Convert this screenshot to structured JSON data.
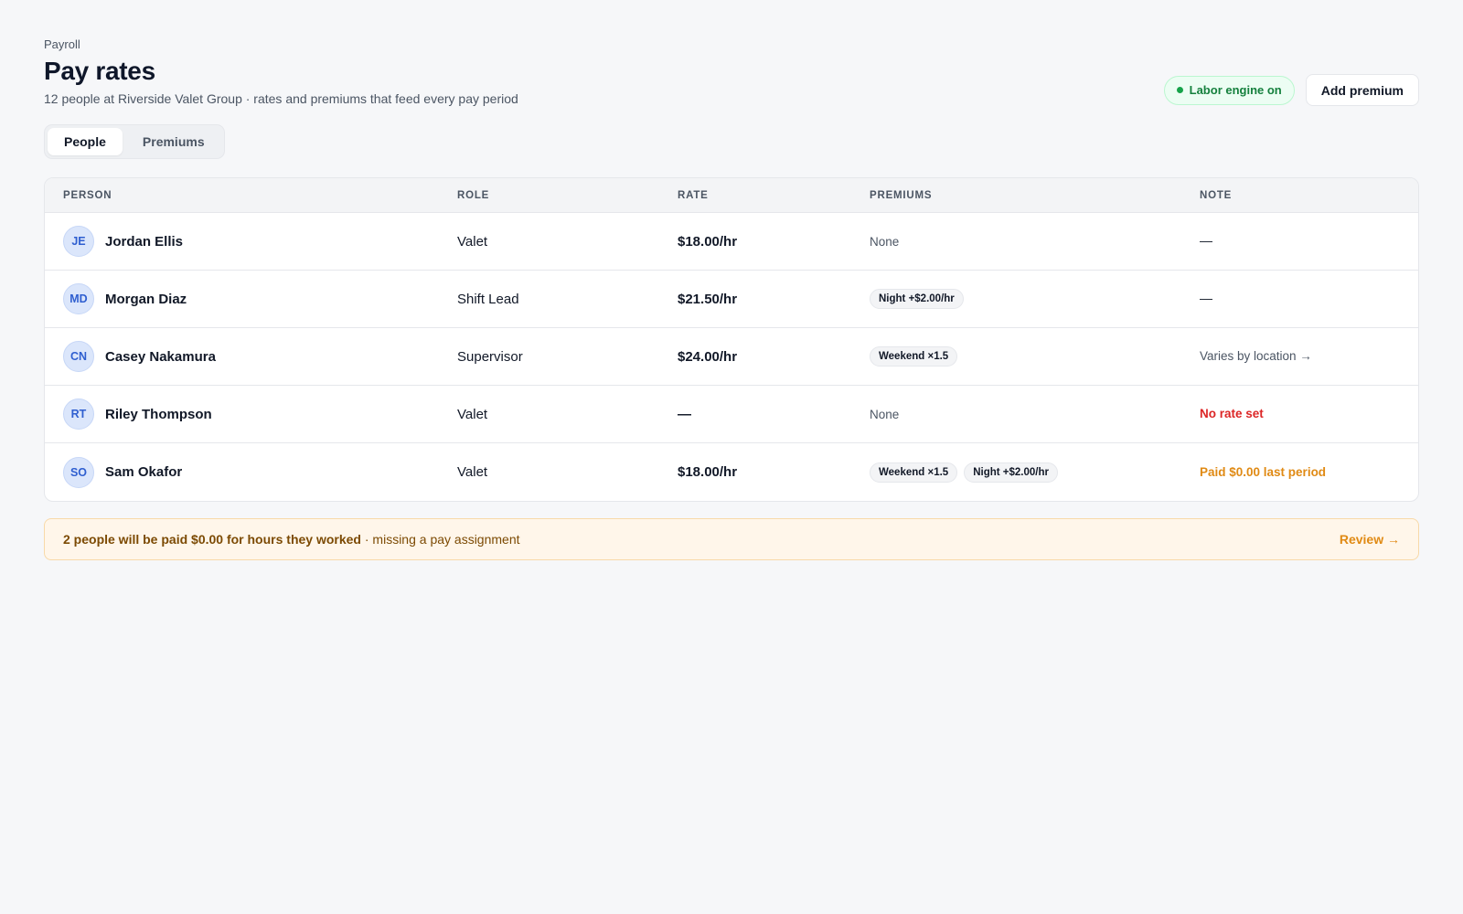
{
  "header": {
    "breadcrumb": "Payroll",
    "title": "Pay rates",
    "subtitle": "12 people at Riverside Valet Group · rates and premiums that feed every pay period",
    "engine_status": "Labor engine on",
    "add_button": "Add premium"
  },
  "tabs": [
    {
      "label": "People",
      "active": true
    },
    {
      "label": "Premiums",
      "active": false
    }
  ],
  "table": {
    "columns": [
      "PERSON",
      "ROLE",
      "RATE",
      "PREMIUMS",
      "NOTE"
    ],
    "rows": [
      {
        "initials": "JE",
        "name": "Jordan Ellis",
        "role": "Valet",
        "rate": "$18.00/hr",
        "premiums_none": "None",
        "premiums": [],
        "note": "—",
        "note_style": "dash"
      },
      {
        "initials": "MD",
        "name": "Morgan Diaz",
        "role": "Shift Lead",
        "rate": "$21.50/hr",
        "premiums": [
          "Night +$2.00/hr"
        ],
        "note": "—",
        "note_style": "dash"
      },
      {
        "initials": "CN",
        "name": "Casey Nakamura",
        "role": "Supervisor",
        "rate": "$24.00/hr",
        "premiums": [
          "Weekend ×1.5"
        ],
        "note": "Varies by location →",
        "note_style": "link"
      },
      {
        "initials": "RT",
        "name": "Riley Thompson",
        "role": "Valet",
        "rate": "—",
        "premiums_none": "None",
        "premiums": [],
        "note": "No rate set",
        "note_style": "error"
      },
      {
        "initials": "SO",
        "name": "Sam Okafor",
        "role": "Valet",
        "rate": "$18.00/hr",
        "premiums": [
          "Weekend ×1.5",
          "Night +$2.00/hr"
        ],
        "note": "Paid $0.00 last period",
        "note_style": "warning"
      }
    ]
  },
  "warning": {
    "strong": "2 people will be paid $0.00 for hours they worked",
    "rest": " · missing a pay assignment",
    "action": "Review →"
  },
  "colors": {
    "accent": "#2f5fd0",
    "success": "#16a34a",
    "error": "#dc2626",
    "warning": "#e08a14"
  }
}
